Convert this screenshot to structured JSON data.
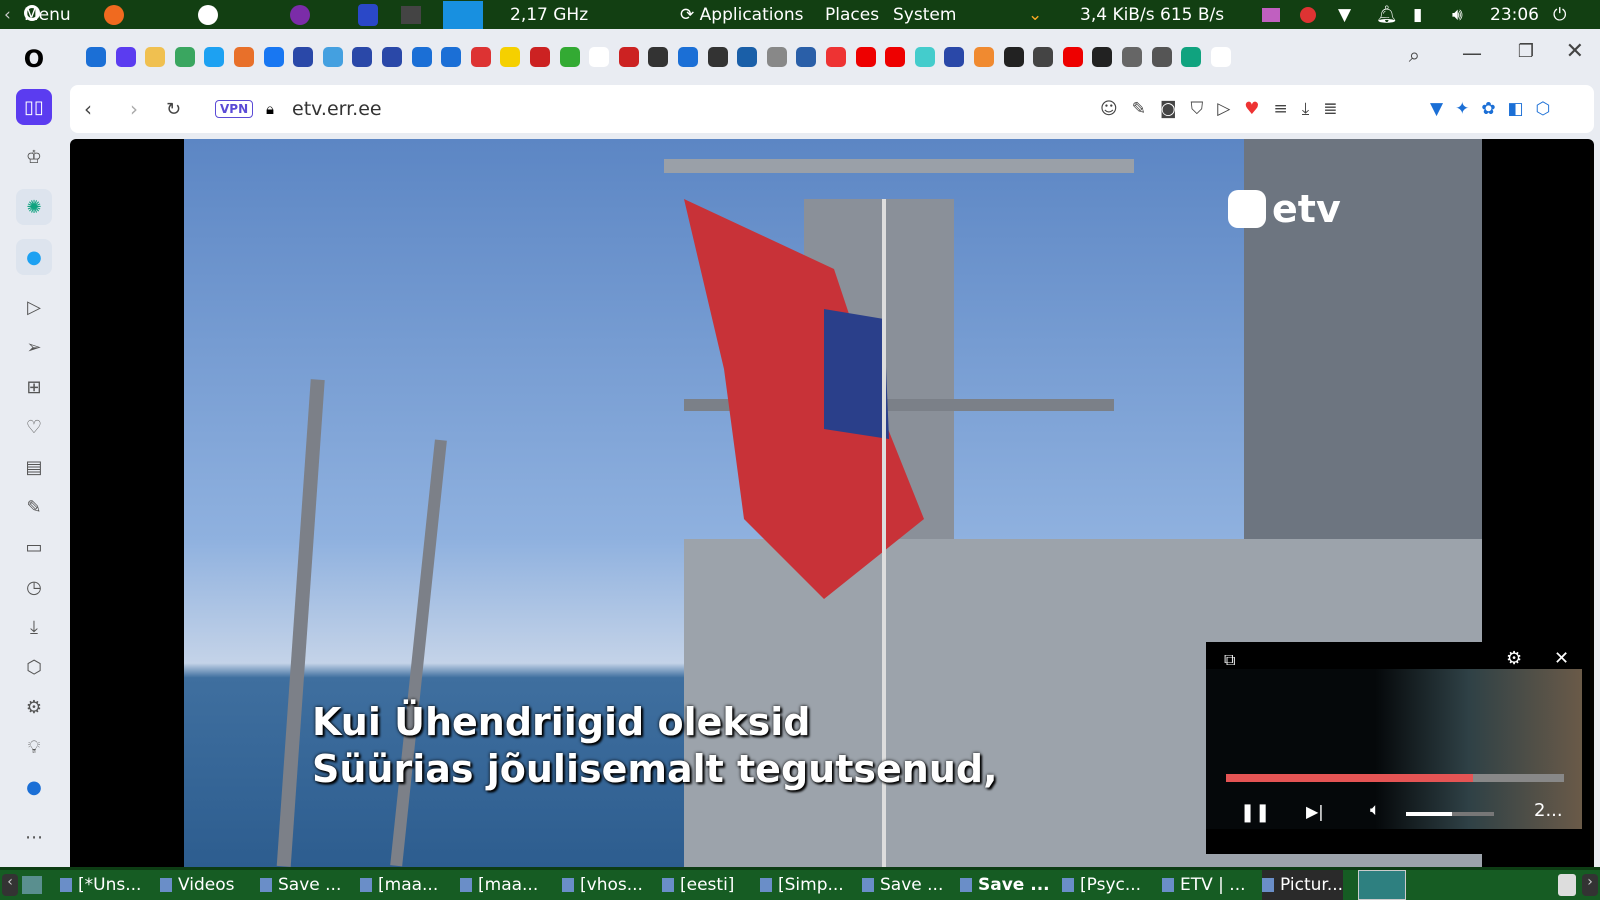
{
  "top_panel": {
    "menu": "Menu",
    "cpu_freq": "2,17 GHz",
    "applications": "Applications",
    "places": "Places",
    "system": "System",
    "net_down": "3,4 KiB/s",
    "net_up": "615 B/s",
    "clock": "23:06"
  },
  "browser": {
    "url": "etv.err.ee",
    "vpn": "VPN"
  },
  "video": {
    "logo": "etv",
    "subtitle_line1": "Kui Ühendriigid oleksid",
    "subtitle_line2": "Süürias jõulisemalt tegutsenud,"
  },
  "pip": {
    "progress": 0.73,
    "volume": 0.52,
    "time": "2..."
  },
  "taskbar": {
    "items": [
      "[*Uns...",
      "Videos",
      "Save ...",
      "[maa...",
      "[maa...",
      "[vhos...",
      "[eesti]",
      "[Simp...",
      "Save ...",
      "Save ...",
      "[Psyc...",
      "ETV | ...",
      "Pictur..."
    ]
  }
}
